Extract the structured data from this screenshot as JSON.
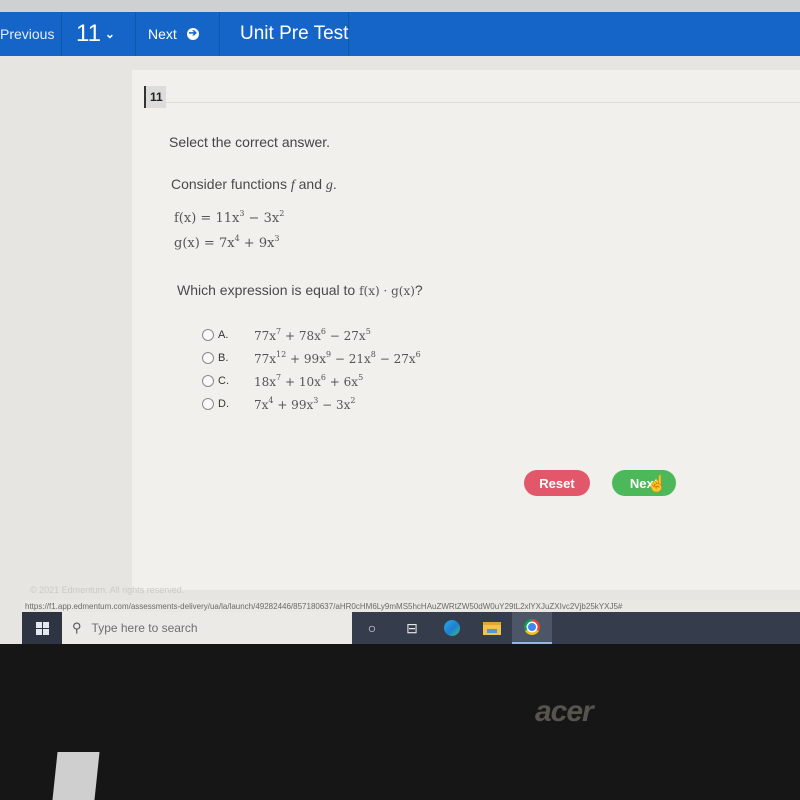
{
  "nav": {
    "previous_label": "Previous",
    "question_number": "11",
    "next_label": "Next",
    "title": "Unit Pre Test"
  },
  "question": {
    "label": "11",
    "instruction": "Select the correct answer.",
    "consider_prefix": "Consider functions ",
    "consider_f": "f",
    "consider_and": " and ",
    "consider_g": "g",
    "consider_suffix": ".",
    "f_def": {
      "lhs": "f(x) = 11x",
      "e1": "3",
      "mid": " − 3x",
      "e2": "2"
    },
    "g_def": {
      "lhs": "g(x) = 7x",
      "e1": "4",
      "mid": " + 9x",
      "e2": "3"
    },
    "prompt": "Which expression is equal to ",
    "prompt_math": "f(x) · g(x)",
    "prompt_end": "?"
  },
  "options": [
    {
      "letter": "A.",
      "terms": [
        "77x",
        "7",
        " + 78x",
        "6",
        " − 27x",
        "5"
      ],
      "selected": false
    },
    {
      "letter": "B.",
      "terms": [
        "77x",
        "12",
        " + 99x",
        "9",
        " − 21x",
        "8",
        " − 27x",
        "6"
      ],
      "selected": false
    },
    {
      "letter": "C.",
      "terms": [
        "18x",
        "7",
        " + 10x",
        "6",
        " + 6x",
        "5"
      ],
      "selected": false
    },
    {
      "letter": "D.",
      "terms": [
        "7x",
        "4",
        " + 99x",
        "3",
        " − 3x",
        "2"
      ],
      "selected": false
    }
  ],
  "buttons": {
    "reset_label": "Reset",
    "next_label": "Next"
  },
  "footer": {
    "copyright": "© 2021 Edmentum. All rights reserved.",
    "status_url": "https://f1.app.edmentum.com/assessments-delivery/ua/la/launch/49282446/857180637/aHR0cHM6Ly9mMS5hcHAuZWRtZW50dW0uY29tL2xlYXJuZXIvc2Vjb25kYXJ5#"
  },
  "taskbar": {
    "search_placeholder": "Type here to search",
    "icons": [
      "cortana-icon",
      "task-view-icon",
      "edge-icon",
      "file-explorer-icon",
      "chrome-icon"
    ]
  },
  "bezel": {
    "brand": "acer"
  },
  "colors": {
    "nav_blue": "#1565c8",
    "reset_red": "#e2586a",
    "next_green": "#4cb85a"
  }
}
